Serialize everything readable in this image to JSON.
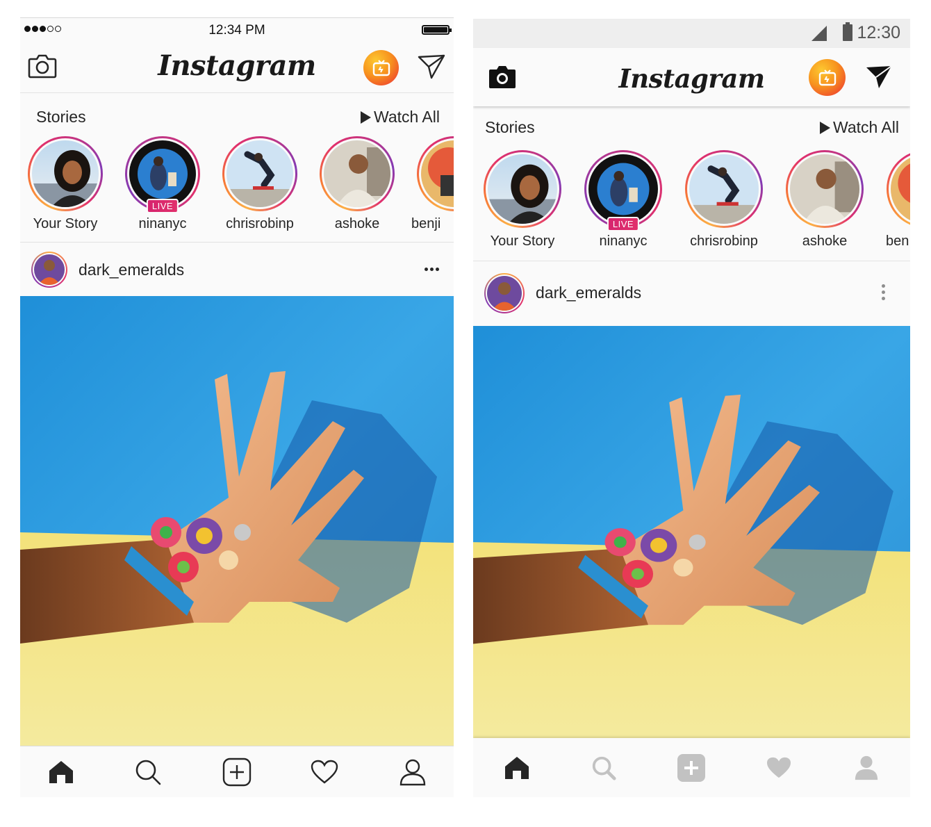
{
  "ios": {
    "status": {
      "time": "12:34 PM"
    },
    "header": {
      "logo": "Instagram"
    },
    "stories": {
      "title": "Stories",
      "watch_all": "Watch All",
      "live_badge": "LIVE",
      "items": [
        {
          "name": "Your Story"
        },
        {
          "name": "ninanyc",
          "live": true
        },
        {
          "name": "chrisrobinp"
        },
        {
          "name": "ashoke"
        },
        {
          "name": "benji"
        }
      ]
    },
    "post": {
      "username": "dark_emeralds"
    }
  },
  "android": {
    "status": {
      "time": "12:30"
    },
    "header": {
      "logo": "Instagram"
    },
    "stories": {
      "title": "Stories",
      "watch_all": "Watch All",
      "live_badge": "LIVE",
      "items": [
        {
          "name": "Your Story"
        },
        {
          "name": "ninanyc",
          "live": true
        },
        {
          "name": "chrisrobinp"
        },
        {
          "name": "ashoke"
        },
        {
          "name": "ben"
        }
      ]
    },
    "post": {
      "username": "dark_emeralds"
    }
  },
  "tabs": [
    "home-icon",
    "search-icon",
    "add-icon",
    "heart-icon",
    "profile-icon"
  ],
  "colors": {
    "igtv_gradient": [
      "#fdc830",
      "#f15a29",
      "#e6257f"
    ],
    "live_badge": "#e1306c",
    "wall_blue": "#2a9fe3",
    "ledge_yellow": "#f0e38a"
  }
}
